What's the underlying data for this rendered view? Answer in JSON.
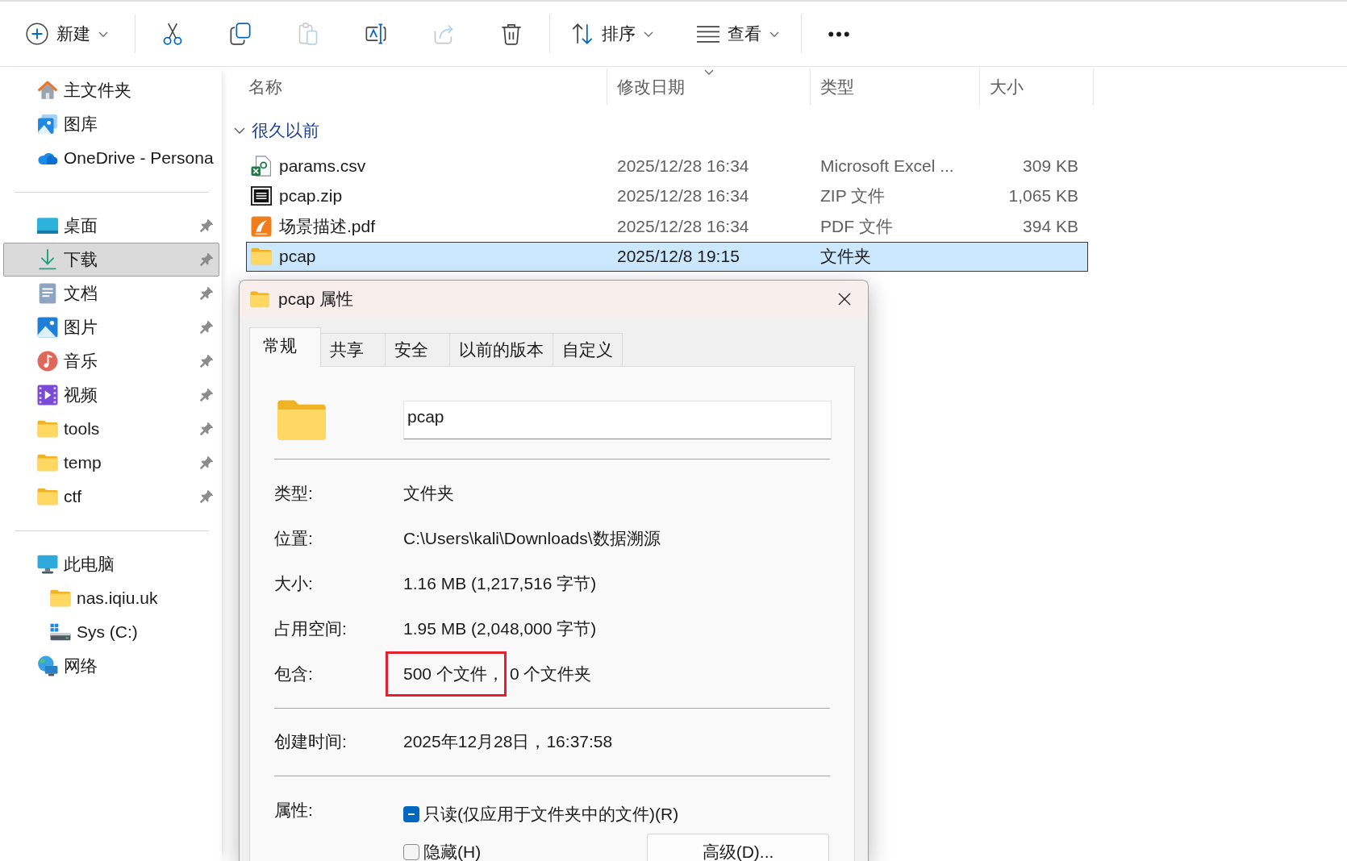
{
  "toolbar": {
    "items": [
      {
        "kind": "new",
        "label": "新建",
        "dropdown": true,
        "disabled": false
      },
      {
        "kind": "separator"
      },
      {
        "kind": "cut",
        "disabled": false
      },
      {
        "kind": "copy",
        "disabled": false
      },
      {
        "kind": "paste",
        "disabled": true
      },
      {
        "kind": "rename",
        "disabled": false
      },
      {
        "kind": "share",
        "disabled": true
      },
      {
        "kind": "delete",
        "disabled": false
      },
      {
        "kind": "separator"
      },
      {
        "kind": "sort",
        "label": "排序",
        "dropdown": true,
        "disabled": false
      },
      {
        "kind": "view",
        "label": "查看",
        "dropdown": true,
        "disabled": false
      },
      {
        "kind": "separator"
      },
      {
        "kind": "more",
        "disabled": false
      }
    ]
  },
  "sidebar": {
    "sections": [
      {
        "items": [
          {
            "kind": "home",
            "label": "主文件夹",
            "pinned": false,
            "selected": false
          },
          {
            "kind": "gallery",
            "label": "图库",
            "pinned": false,
            "selected": false
          },
          {
            "kind": "cloud",
            "label": "OneDrive - Persona",
            "pinned": false,
            "selected": false
          }
        ]
      },
      {
        "items": [
          {
            "kind": "desktop",
            "label": "桌面",
            "pinned": true,
            "selected": false
          },
          {
            "kind": "downloads",
            "label": "下载",
            "pinned": true,
            "selected": true
          },
          {
            "kind": "documents",
            "label": "文档",
            "pinned": true,
            "selected": false
          },
          {
            "kind": "pictures",
            "label": "图片",
            "pinned": true,
            "selected": false
          },
          {
            "kind": "music",
            "label": "音乐",
            "pinned": true,
            "selected": false
          },
          {
            "kind": "videos",
            "label": "视频",
            "pinned": true,
            "selected": false
          },
          {
            "kind": "folder",
            "label": "tools",
            "pinned": true,
            "selected": false
          },
          {
            "kind": "folder",
            "label": "temp",
            "pinned": true,
            "selected": false
          },
          {
            "kind": "folder",
            "label": "ctf",
            "pinned": true,
            "selected": false
          }
        ]
      },
      {
        "items": [
          {
            "kind": "pc",
            "label": "此电脑",
            "pinned": false,
            "selected": false,
            "children": [
              {
                "kind": "folder",
                "label": "nas.iqiu.uk",
                "pinned": false,
                "selected": false
              },
              {
                "kind": "drive",
                "label": "Sys (C:)",
                "pinned": false,
                "selected": false
              }
            ]
          },
          {
            "kind": "network",
            "label": "网络",
            "pinned": false,
            "selected": false
          }
        ]
      }
    ]
  },
  "file_list": {
    "columns": [
      {
        "label": "名称",
        "sorted": false
      },
      {
        "label": "修改日期",
        "sorted": true
      },
      {
        "label": "类型",
        "sorted": false
      },
      {
        "label": "大小",
        "sorted": false
      }
    ],
    "groups": [
      {
        "label": "很久以前",
        "expanded": true,
        "rows": [
          {
            "kind": "spreadsheet",
            "name": "params.csv",
            "date": "2025/12/28 16:34",
            "type": "Microsoft Excel ...",
            "size": "309 KB",
            "selected": false
          },
          {
            "kind": "archive",
            "name": "pcap.zip",
            "date": "2025/12/28 16:34",
            "type": "ZIP 文件",
            "size": "1,065 KB",
            "selected": false
          },
          {
            "kind": "pdf",
            "name": "场景描述.pdf",
            "date": "2025/12/28 16:34",
            "type": "PDF 文件",
            "size": "394 KB",
            "selected": false
          },
          {
            "kind": "folder",
            "name": "pcap",
            "date": "2025/12/8 19:15",
            "type": "文件夹",
            "selected": true
          }
        ]
      }
    ]
  },
  "dialog": {
    "title": "pcap 属性",
    "tabs": [
      {
        "label": "常规",
        "selected": true
      },
      {
        "label": "共享",
        "selected": false
      },
      {
        "label": "安全",
        "selected": false
      },
      {
        "label": "以前的版本",
        "selected": false
      },
      {
        "label": "自定义",
        "selected": false
      }
    ],
    "name": "pcap",
    "sections": [
      {
        "rows": [
          {
            "label": "类型:",
            "parts": [
              {
                "text": "文件夹",
                "highlighted": false
              }
            ]
          },
          {
            "label": "位置:",
            "parts": [
              {
                "text": "C:\\Users\\kali\\Downloads\\数据溯源",
                "highlighted": false
              }
            ]
          },
          {
            "label": "大小:",
            "parts": [
              {
                "text": "1.16 MB (1,217,516 字节)",
                "highlighted": false
              }
            ]
          },
          {
            "label": "占用空间:",
            "parts": [
              {
                "text": "1.95 MB (2,048,000 字节)",
                "highlighted": false
              }
            ]
          },
          {
            "label": "包含:",
            "parts": [
              {
                "text": "500 个文件，",
                "highlighted": true
              },
              {
                "text": "0 个文件夹",
                "highlighted": false
              }
            ]
          }
        ]
      },
      {
        "rows": [
          {
            "label": "创建时间:",
            "parts": [
              {
                "text": "2025年12月28日，16:37:58",
                "highlighted": false
              }
            ]
          }
        ]
      }
    ],
    "attributes": {
      "label": "属性:",
      "checkboxes": [
        {
          "label": "只读(仅应用于文件夹中的文件)(R)",
          "checked": true,
          "indeterminate": true
        },
        {
          "label": "隐藏(H)",
          "checked": false,
          "indeterminate": false
        }
      ],
      "advanced_button": "高级(D)..."
    }
  }
}
